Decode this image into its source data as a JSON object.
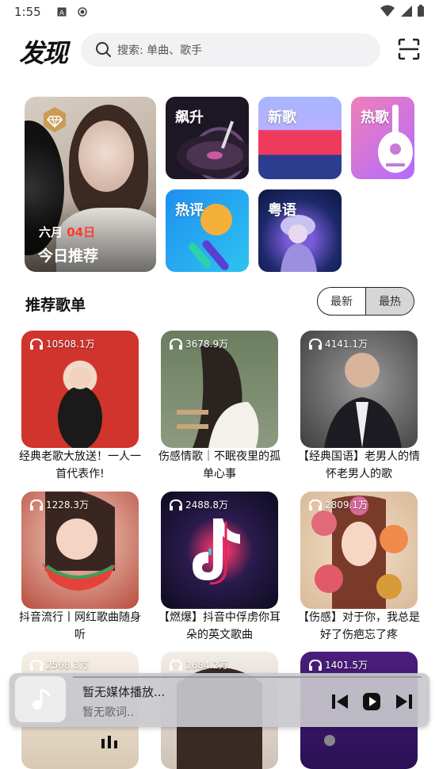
{
  "status_bar": {
    "time": "1:55"
  },
  "header": {
    "logo_text": "发现",
    "search_placeholder": "搜索: 单曲、歌手"
  },
  "featured": {
    "month": "六月",
    "day": "04日",
    "title": "今日推荐"
  },
  "tiles": [
    {
      "label": "飙升"
    },
    {
      "label": "新歌"
    },
    {
      "label": "热歌"
    },
    {
      "label": "热评"
    },
    {
      "label": "粤语"
    }
  ],
  "section": {
    "title": "推荐歌单",
    "tab_new": "最新",
    "tab_hot": "最热",
    "active_tab": "最热"
  },
  "playlists": [
    {
      "count": "10508.1万",
      "title": "经典老歌大放送！一人一首代表作!"
    },
    {
      "count": "3678.9万",
      "title": "伤感情歌｜不眠夜里的孤单心事"
    },
    {
      "count": "4141.1万",
      "title": "【经典国语】老男人的情怀老男人的歌"
    },
    {
      "count": "1228.3万",
      "title": "抖音流行丨网红歌曲随身听"
    },
    {
      "count": "2488.8万",
      "title": "【燃爆】抖音中俘虏你耳朵的英文歌曲"
    },
    {
      "count": "2809.1万",
      "title": "【伤感】对于你，我总是好了伤疤忘了疼"
    },
    {
      "count": "2568.3万",
      "title": ""
    },
    {
      "count": "1684.2万",
      "title": ""
    },
    {
      "count": "1401.5万",
      "title": ""
    }
  ],
  "player": {
    "title": "暂无媒体播放...",
    "lyric": "暂无歌词.."
  },
  "colors": {
    "accent_red": "#ff3b30",
    "player_bg": "#c8c8cd"
  }
}
